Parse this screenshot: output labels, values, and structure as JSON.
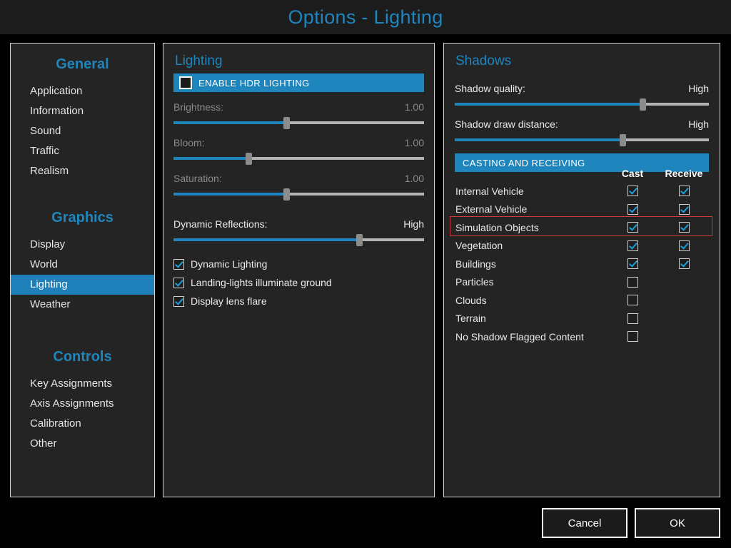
{
  "window": {
    "title": "Options - Lighting",
    "accent_color": "#1f85bd",
    "background_color": "#000000",
    "panel_color": "#242424",
    "highlight_color": "#cf3b3b"
  },
  "sidebar": {
    "groups": [
      {
        "title": "General",
        "items": [
          {
            "label": "Application",
            "selected": false
          },
          {
            "label": "Information",
            "selected": false
          },
          {
            "label": "Sound",
            "selected": false
          },
          {
            "label": "Traffic",
            "selected": false
          },
          {
            "label": "Realism",
            "selected": false
          }
        ]
      },
      {
        "title": "Graphics",
        "items": [
          {
            "label": "Display",
            "selected": false
          },
          {
            "label": "World",
            "selected": false
          },
          {
            "label": "Lighting",
            "selected": true
          },
          {
            "label": "Weather",
            "selected": false
          }
        ]
      },
      {
        "title": "Controls",
        "items": [
          {
            "label": "Key Assignments",
            "selected": false
          },
          {
            "label": "Axis Assignments",
            "selected": false
          },
          {
            "label": "Calibration",
            "selected": false
          },
          {
            "label": "Other",
            "selected": false
          }
        ]
      }
    ]
  },
  "lighting": {
    "heading": "Lighting",
    "hdr_banner": {
      "label": "ENABLE HDR LIGHTING",
      "checked": false
    },
    "sliders": [
      {
        "label": "Brightness:",
        "value": "1.00",
        "percent": 45,
        "enabled": false
      },
      {
        "label": "Bloom:",
        "value": "1.00",
        "percent": 30,
        "enabled": false
      },
      {
        "label": "Saturation:",
        "value": "1.00",
        "percent": 45,
        "enabled": false
      },
      {
        "label": "Dynamic Reflections:",
        "value": "High",
        "percent": 74,
        "enabled": true
      }
    ],
    "checkboxes": [
      {
        "label": "Dynamic Lighting",
        "checked": true
      },
      {
        "label": "Landing-lights illuminate ground",
        "checked": true
      },
      {
        "label": "Display lens flare",
        "checked": true
      }
    ]
  },
  "shadows": {
    "heading": "Shadows",
    "sliders": [
      {
        "label": "Shadow quality:",
        "value": "High",
        "percent": 74
      },
      {
        "label": "Shadow draw distance:",
        "value": "High",
        "percent": 66
      }
    ],
    "banner": "CASTING AND RECEIVING",
    "columns": {
      "name": "",
      "cast": "Cast",
      "receive": "Receive"
    },
    "rows": [
      {
        "name": "Internal Vehicle",
        "cast": true,
        "receive": true,
        "has_receive": true,
        "highlighted": false
      },
      {
        "name": "External Vehicle",
        "cast": true,
        "receive": true,
        "has_receive": true,
        "highlighted": false
      },
      {
        "name": "Simulation Objects",
        "cast": true,
        "receive": true,
        "has_receive": true,
        "highlighted": true
      },
      {
        "name": "Vegetation",
        "cast": true,
        "receive": true,
        "has_receive": true,
        "highlighted": false
      },
      {
        "name": "Buildings",
        "cast": true,
        "receive": true,
        "has_receive": true,
        "highlighted": false
      },
      {
        "name": "Particles",
        "cast": false,
        "receive": false,
        "has_receive": false,
        "highlighted": false
      },
      {
        "name": "Clouds",
        "cast": false,
        "receive": false,
        "has_receive": false,
        "highlighted": false
      },
      {
        "name": "Terrain",
        "cast": false,
        "receive": false,
        "has_receive": false,
        "highlighted": false
      },
      {
        "name": "No Shadow Flagged Content",
        "cast": false,
        "receive": false,
        "has_receive": false,
        "highlighted": false
      }
    ]
  },
  "footer": {
    "cancel_label": "Cancel",
    "ok_label": "OK"
  }
}
